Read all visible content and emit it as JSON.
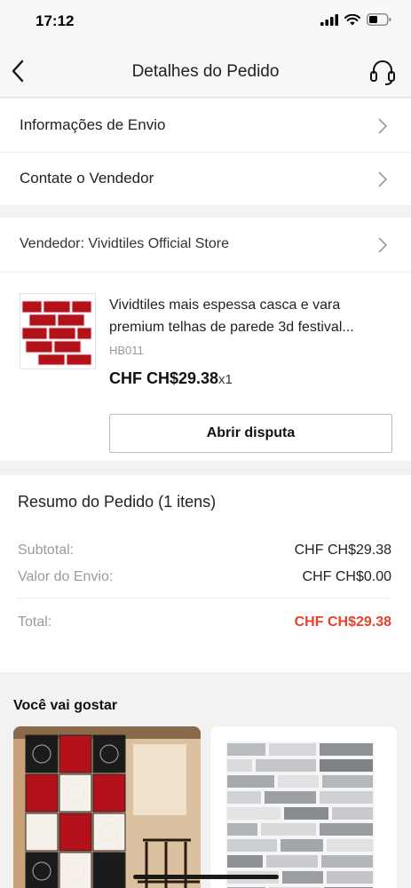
{
  "status_bar": {
    "time": "17:12"
  },
  "header": {
    "title": "Detalhes do Pedido"
  },
  "menu": {
    "shipping_info": "Informações de Envio",
    "contact_seller": "Contate o Vendedor"
  },
  "seller": {
    "label": "Vendedor: Vividtiles Official Store"
  },
  "product": {
    "title_line1": "Vividtiles mais espessa casca e vara",
    "title_line2": "premium telhas de parede 3d festival...",
    "sku": "HB011",
    "price": "CHF CH$29.38",
    "quantity": "x1"
  },
  "actions": {
    "dispute": "Abrir disputa"
  },
  "summary": {
    "title": "Resumo do Pedido (1 itens)",
    "subtotal_label": "Subtotal:",
    "subtotal_value": "CHF CH$29.38",
    "shipping_label": "Valor do Envio:",
    "shipping_value": "CHF CH$0.00",
    "total_label": "Total:",
    "total_value": "CHF CH$29.38"
  },
  "recommendations": {
    "title": "Você vai gostar"
  },
  "colors": {
    "accent_red": "#e5422b",
    "tile_red": "#b3121a"
  }
}
